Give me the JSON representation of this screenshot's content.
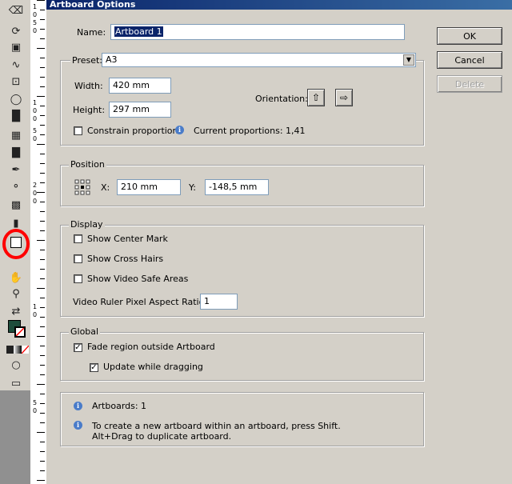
{
  "dialog": {
    "title": "Artboard Options",
    "name_label": "Name:",
    "name_value": "Artboard 1"
  },
  "buttons": {
    "ok": "OK",
    "cancel": "Cancel",
    "delete": "Delete"
  },
  "preset": {
    "label": "Preset:",
    "value": "A3",
    "width_label": "Width:",
    "width_value": "420 mm",
    "height_label": "Height:",
    "height_value": "297 mm",
    "orientation_label": "Orientation:",
    "constrain_label": "Constrain proportions",
    "constrain_checked": false,
    "proportions_text": "Current proportions: 1,41"
  },
  "position": {
    "title": "Position",
    "x_label": "X:",
    "x_value": "210 mm",
    "y_label": "Y:",
    "y_value": "-148,5 mm"
  },
  "display": {
    "title": "Display",
    "center_mark": "Show Center Mark",
    "cross_hairs": "Show Cross Hairs",
    "video_safe": "Show Video Safe Areas",
    "aspect_label": "Video Ruler Pixel Aspect Ratio:",
    "aspect_value": "1"
  },
  "global": {
    "title": "Global",
    "fade": "Fade region outside Artboard",
    "fade_checked": true,
    "update": "Update while dragging",
    "update_checked": true
  },
  "info": {
    "artboards": "Artboards: 1",
    "tip_line1": "To create a new artboard within an artboard, press Shift.",
    "tip_line2": "Alt+Drag to duplicate artboard."
  },
  "ruler": {
    "labels": [
      "1",
      "0",
      "5",
      "0",
      "1",
      "0",
      "0",
      "5",
      "0",
      "2",
      "0",
      "0",
      "1",
      "0",
      "5",
      "0"
    ]
  },
  "colors": {
    "highlight_circle": "#ff0000",
    "title_bar": "#0a246a"
  }
}
